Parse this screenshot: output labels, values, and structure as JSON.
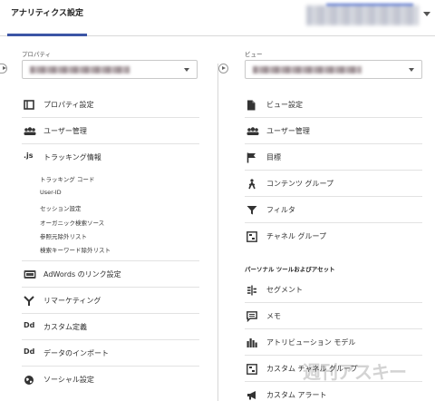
{
  "topbar": {
    "tab_label": "アナリティクス設定"
  },
  "property": {
    "section_label": "プロパティ",
    "items": [
      {
        "label": "プロパティ設定",
        "icon": "property-icon"
      },
      {
        "label": "ユーザー管理",
        "icon": "users-icon"
      },
      {
        "label": "トラッキング情報",
        "icon": "js-icon"
      }
    ],
    "tracking_subitems": [
      "トラッキング コード",
      "User-ID",
      "セッション設定",
      "オーガニック検索ソース",
      "参照元除外リスト",
      "検索キーワード除外リスト"
    ],
    "items_after": [
      {
        "label": "AdWords のリンク設定",
        "icon": "adwords-icon"
      },
      {
        "label": "リマーケティング",
        "icon": "remarketing-icon"
      },
      {
        "label": "カスタム定義",
        "icon": "dd-icon"
      },
      {
        "label": "データのインポート",
        "icon": "dd-icon"
      },
      {
        "label": "ソーシャル設定",
        "icon": "globe-icon"
      }
    ],
    "dd_glyph": "Dd",
    "js_glyph": ".js"
  },
  "view": {
    "section_label": "ビュー",
    "items": [
      {
        "label": "ビュー設定",
        "icon": "document-icon"
      },
      {
        "label": "ユーザー管理",
        "icon": "users-icon"
      },
      {
        "label": "目標",
        "icon": "flag-icon"
      },
      {
        "label": "コンテンツ グループ",
        "icon": "person-walk-icon"
      },
      {
        "label": "フィルタ",
        "icon": "filter-icon"
      },
      {
        "label": "チャネル グループ",
        "icon": "channel-icon"
      }
    ],
    "personal_heading": "パーソナル ツールおよびアセット",
    "personal_items": [
      {
        "label": "セグメント",
        "icon": "segment-icon"
      },
      {
        "label": "メモ",
        "icon": "note-icon"
      },
      {
        "label": "アトリビューション モデル",
        "icon": "bar-chart-icon"
      },
      {
        "label": "カスタム チャネル グループ",
        "icon": "channel-icon"
      },
      {
        "label": "カスタム アラート",
        "icon": "megaphone-icon"
      }
    ]
  },
  "watermark": "週刊アスキー",
  "colors": {
    "accent": "#3c55a6",
    "text": "#2e2e2e",
    "divider": "#e2e2e2"
  }
}
